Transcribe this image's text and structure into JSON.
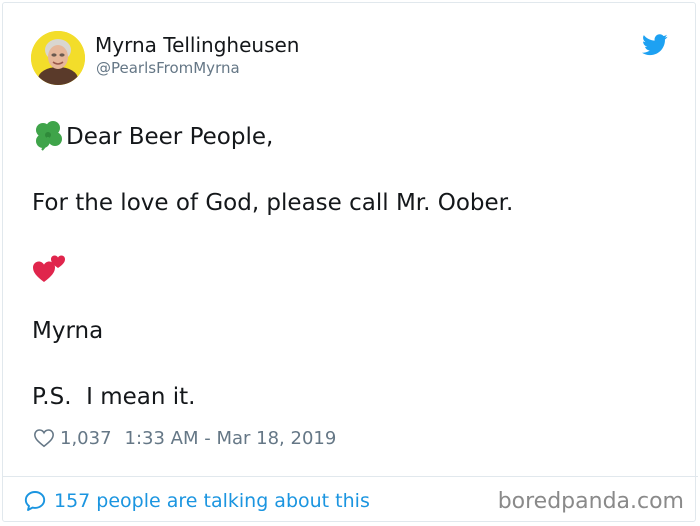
{
  "tweet": {
    "display_name": "Myrna Tellingheusen",
    "handle": "@PearlsFromMyrna",
    "avatar_icon": "user-avatar",
    "brand_icon": "twitter-bird-icon",
    "lines": [
      {
        "emoji": "four-leaf-clover-icon",
        "text": "Dear Beer People,"
      },
      {
        "text": "For the love of God, please call Mr. Oober."
      },
      {
        "emoji": "two-hearts-icon",
        "text": ""
      },
      {
        "text": "Myrna"
      },
      {
        "text": "P.S.  I mean it."
      }
    ],
    "likes": "1,037",
    "timestamp": "1:33 AM - Mar 18, 2019",
    "conversation": "157 people are talking about this"
  },
  "watermark": "boredpanda.com",
  "colors": {
    "twitter_blue": "#1da1f2",
    "link_blue": "#1b95e0",
    "text": "#14171a",
    "secondary_text": "#657786",
    "border": "#e1e8ed",
    "avatar_bg": "#f3dd2a",
    "clover_green": "#3fa44a",
    "heart_red": "#e0254c"
  }
}
